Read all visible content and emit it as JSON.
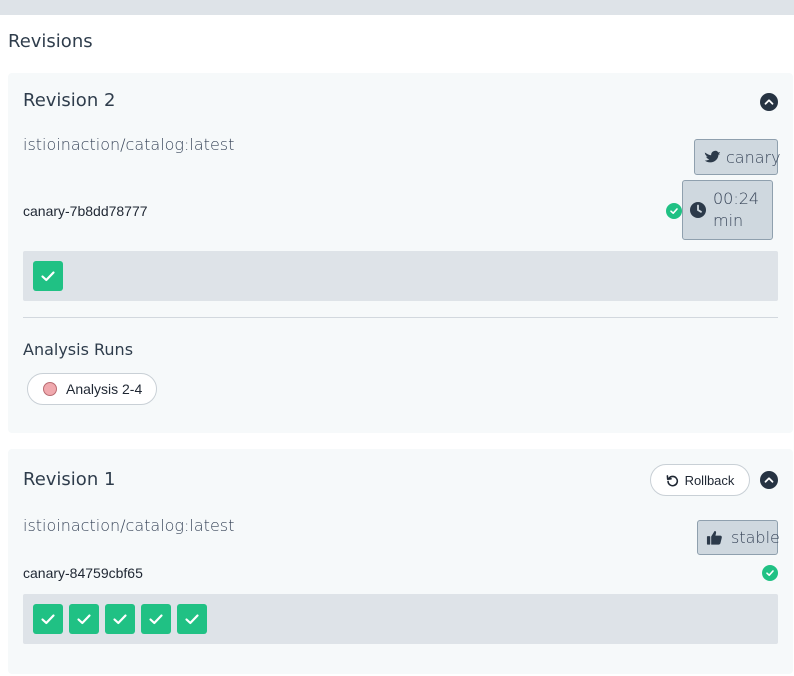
{
  "section_title": "Revisions",
  "revisions": [
    {
      "title": "Revision 2",
      "image": "istioinaction/catalog:latest",
      "tag_label": "canary",
      "tag_icon": "bird-icon",
      "pod_name": "canary-7b8dd78777",
      "timer_value": "00:24",
      "timer_unit": "min",
      "pods_ready": 1,
      "analysis_title": "Analysis Runs",
      "analysis_runs": [
        {
          "label": "Analysis 2-4",
          "status": "failed"
        }
      ]
    },
    {
      "title": "Revision 1",
      "image": "istioinaction/catalog:latest",
      "tag_label": "stable",
      "tag_icon": "thumbs-up-icon",
      "pod_name": "canary-84759cbf65",
      "rollback_label": "Rollback",
      "pods_ready": 5
    }
  ],
  "colors": {
    "success": "#20c184",
    "tag_bg": "#cfd8df",
    "card_bg": "#f6f9fa",
    "analysis_failed": "#f0a9ae"
  }
}
